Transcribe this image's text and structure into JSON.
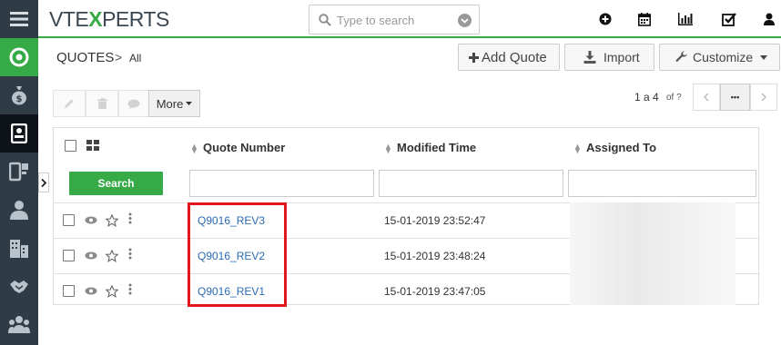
{
  "brand": {
    "logo_pre": "VTE",
    "logo_x": "X",
    "logo_post": "PERTS"
  },
  "search": {
    "placeholder": "Type to search"
  },
  "header": {
    "module": "QUOTES",
    "separator": ">",
    "filter": "All"
  },
  "buttons": {
    "add_quote": "Add Quote",
    "import": "Import",
    "customize": "Customize"
  },
  "toolbar": {
    "more": "More"
  },
  "pagination": {
    "range": "1 a 4",
    "of": "of ?",
    "dots": "•••"
  },
  "table": {
    "headers": {
      "quote_number": "Quote Number",
      "modified_time": "Modified Time",
      "assigned_to": "Assigned To"
    },
    "search_button": "Search",
    "rows": [
      {
        "quote_number": "Q9016_REV3",
        "modified_time": "15-01-2019 23:52:47"
      },
      {
        "quote_number": "Q9016_REV2",
        "modified_time": "15-01-2019 23:48:24"
      },
      {
        "quote_number": "Q9016_REV1",
        "modified_time": "15-01-2019 23:47:05"
      }
    ]
  },
  "colors": {
    "accent": "#35aa47",
    "sidebar": "#2f3b45",
    "link": "#2a6bb4",
    "highlight": "#e3161b"
  }
}
